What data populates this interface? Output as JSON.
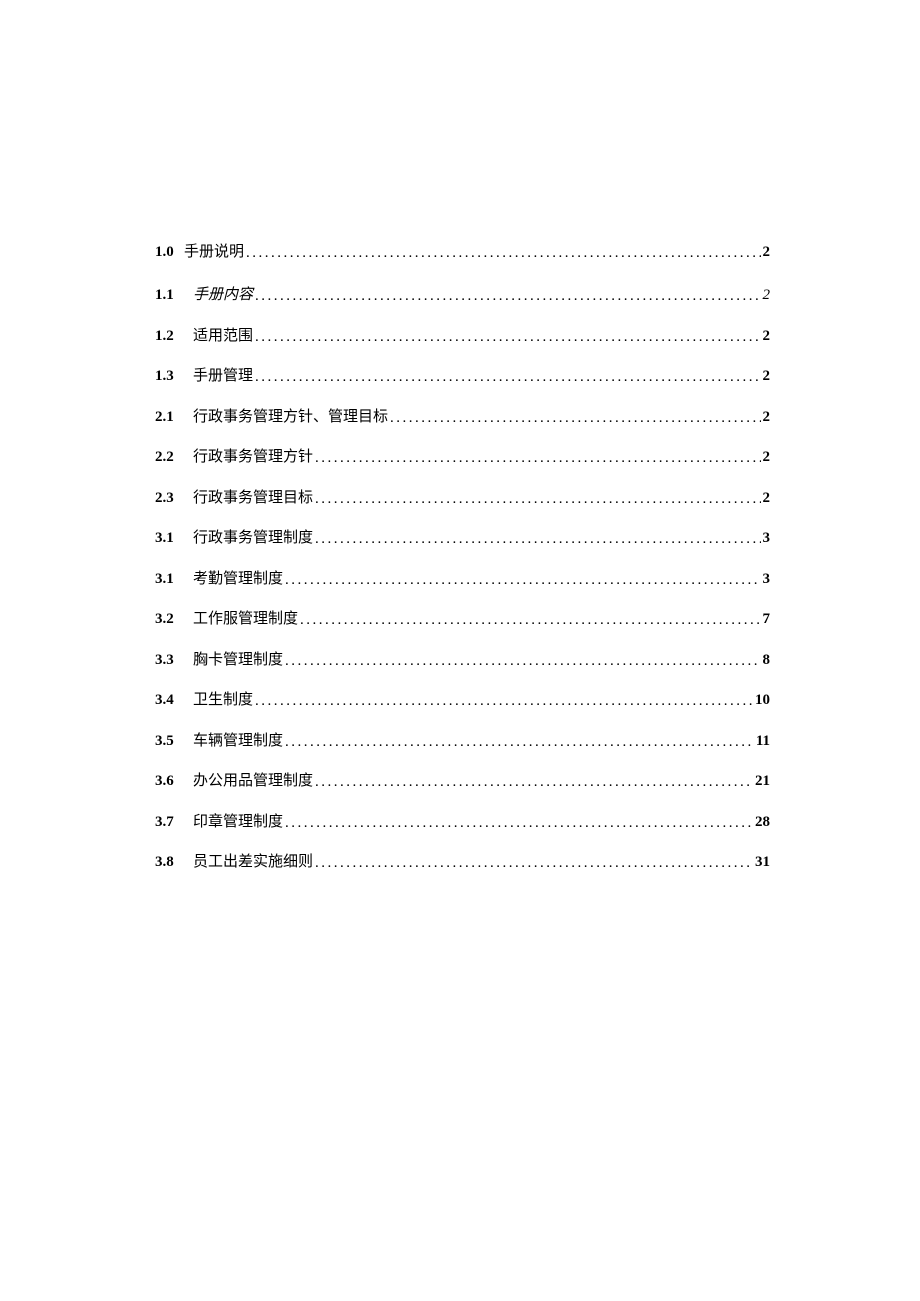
{
  "toc": [
    {
      "num": "1.0",
      "title": "手册说明",
      "page": "2",
      "first": true,
      "italic": false
    },
    {
      "num": "1.1",
      "title": "手册内容",
      "page": "2",
      "first": false,
      "italic": true
    },
    {
      "num": "1.2",
      "title": "适用范围",
      "page": "2",
      "first": false,
      "italic": false
    },
    {
      "num": "1.3",
      "title": "手册管理",
      "page": "2",
      "first": false,
      "italic": false
    },
    {
      "num": "2.1",
      "title": "行政事务管理方针、管理目标",
      "page": "2",
      "first": false,
      "italic": false
    },
    {
      "num": "2.2",
      "title": "行政事务管理方针",
      "page": "2",
      "first": false,
      "italic": false
    },
    {
      "num": "2.3",
      "title": "行政事务管理目标",
      "page": "2",
      "first": false,
      "italic": false
    },
    {
      "num": "3.1",
      "title": "行政事务管理制度",
      "page": "3",
      "first": false,
      "italic": false
    },
    {
      "num": "3.1",
      "title": "考勤管理制度",
      "page": "3",
      "first": false,
      "italic": false
    },
    {
      "num": "3.2",
      "title": "工作服管理制度",
      "page": "7",
      "first": false,
      "italic": false
    },
    {
      "num": "3.3",
      "title": "胸卡管理制度",
      "page": "8",
      "first": false,
      "italic": false
    },
    {
      "num": "3.4",
      "title": "卫生制度",
      "page": "10",
      "first": false,
      "italic": false
    },
    {
      "num": "3.5",
      "title": "车辆管理制度",
      "page": "11",
      "first": false,
      "italic": false
    },
    {
      "num": "3.6",
      "title": "办公用品管理制度",
      "page": "21",
      "first": false,
      "italic": false
    },
    {
      "num": "3.7",
      "title": "印章管理制度",
      "page": "28",
      "first": false,
      "italic": false
    },
    {
      "num": "3.8",
      "title": "员工出差实施细则",
      "page": "31",
      "first": false,
      "italic": false
    }
  ]
}
